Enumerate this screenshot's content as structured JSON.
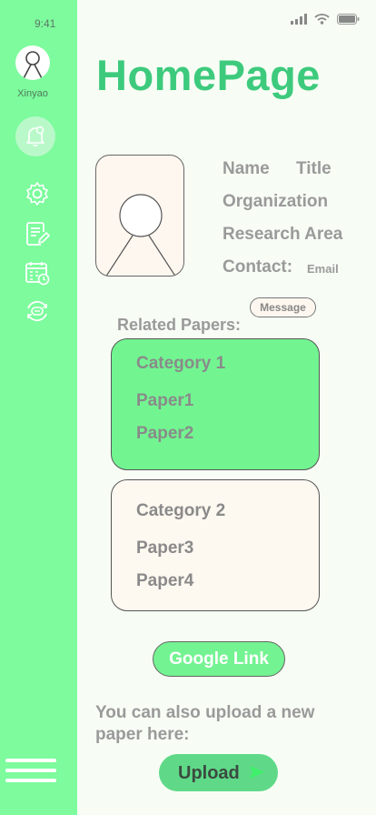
{
  "status_bar": {
    "time": "9:41"
  },
  "sidebar": {
    "user_name": "Xinyao",
    "icons": [
      "avatar-icon",
      "bell-icon",
      "gear-icon",
      "edit-document-icon",
      "calendar-clock-icon",
      "sync-icon",
      "menu-icon"
    ]
  },
  "page": {
    "title": "HomePage"
  },
  "profile": {
    "name": "Name",
    "title": "Title",
    "organization": "Organization",
    "research_area": "Research Area",
    "contact_label": "Contact:",
    "email": "Email",
    "message_button": "Message"
  },
  "papers": {
    "label": "Related Papers:",
    "categories": [
      {
        "name": "Category 1",
        "papers": [
          "Paper1",
          "Paper2"
        ]
      },
      {
        "name": "Category 2",
        "papers": [
          "Paper3",
          "Paper4"
        ]
      }
    ]
  },
  "google_link": "Google Link",
  "upload": {
    "prompt": "You can also upload a new paper here:",
    "button": "Upload"
  },
  "colors": {
    "sidebar": "#7dfb9d",
    "accent": "#3dca7d",
    "card_green": "#72f591",
    "background": "#f7fdf5"
  }
}
